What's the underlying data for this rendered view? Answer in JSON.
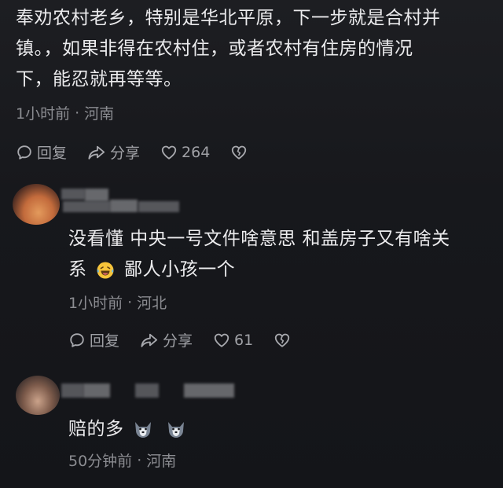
{
  "comments": [
    {
      "text_line1": "奉劝农村老乡，特别是华北平原，下一步就是合村并",
      "text_line2": "镇。，如果非得在农村住，或者农村有住房的情况",
      "text_line3": "下，能忍就再等等。",
      "time": "1小时前",
      "separator": "·",
      "location": "河南",
      "reply_label": "回复",
      "share_label": "分享",
      "likes": "264"
    },
    {
      "text_line1": "没看懂 中央一号文件啥意思 和盖房子又有啥关",
      "text_line2_pre": "系",
      "emoji": "laughing-tears-emoji",
      "text_line2_post": "鄙人小孩一个",
      "time": "1小时前",
      "separator": "·",
      "location": "河北",
      "reply_label": "回复",
      "share_label": "分享",
      "likes": "61"
    },
    {
      "text": "赔的多",
      "emoji": "husky-dog-emoji",
      "time": "50分钟前",
      "separator": "·",
      "location": "河南"
    }
  ],
  "colors": {
    "background": "#17181c",
    "text": "#ebebed",
    "meta": "#8b8c91",
    "action": "#9fa0a5"
  }
}
